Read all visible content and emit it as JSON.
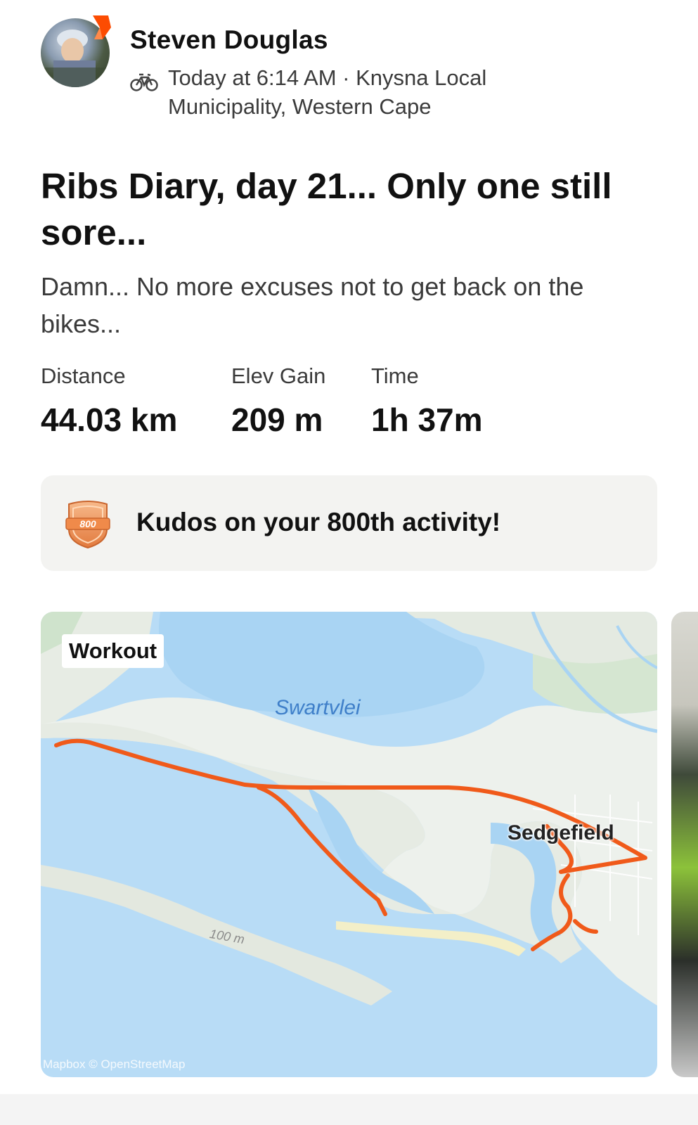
{
  "athlete": {
    "name": "Steven Douglas",
    "activity_type_icon": "bike-icon",
    "meta_text": "Today at 6:14 AM · Knysna Local Municipality, Western Cape"
  },
  "activity": {
    "title": "Ribs Diary, day 21... Only one still sore...",
    "description": "Damn... No more excuses not to get back on the bikes..."
  },
  "stats": [
    {
      "label": "Distance",
      "value": "44.03 km"
    },
    {
      "label": "Elev Gain",
      "value": "209 m"
    },
    {
      "label": "Time",
      "value": "1h 37m"
    }
  ],
  "kudos": {
    "badge_text": "800",
    "message": "Kudos on your 800th activity!"
  },
  "map": {
    "tag": "Workout",
    "water_label": "Swartvlei",
    "town_label": "Sedgefield",
    "contour_label": "100 m",
    "attribution": "Mapbox © OpenStreetMap",
    "route_color": "#f05a1a"
  },
  "colors": {
    "brand": "#fc4c02",
    "water": "#b8dcf6",
    "land": "#eef2ee"
  }
}
